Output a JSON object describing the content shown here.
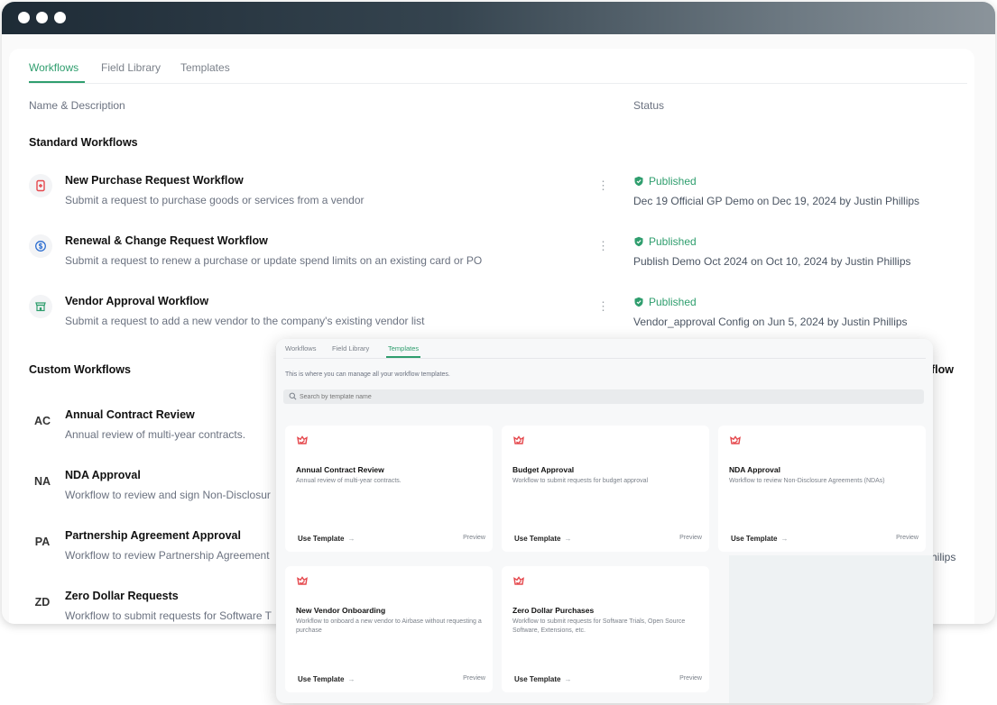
{
  "tabs": [
    "Workflows",
    "Field Library",
    "Templates"
  ],
  "columns": {
    "name": "Name & Description",
    "status": "Status"
  },
  "sections": {
    "standard": "Standard Workflows",
    "custom": "Custom Workflows"
  },
  "standard_workflows": [
    {
      "title": "New Purchase Request Workflow",
      "desc": "Submit a request to purchase goods or services from a vendor",
      "icon": "document-plus-icon",
      "status": "Published",
      "meta": "Dec 19 Official GP Demo on Dec 19, 2024 by Justin Phillips"
    },
    {
      "title": "Renewal & Change Request Workflow",
      "desc": "Submit a request to renew a purchase or update spend limits on an existing card or PO",
      "icon": "dollar-renew-icon",
      "status": "Published",
      "meta": "Publish Demo Oct 2024 on Oct 10, 2024 by Justin Phillips"
    },
    {
      "title": "Vendor Approval Workflow",
      "desc": "Submit a request to add a new vendor to the company's existing vendor list",
      "icon": "store-icon",
      "status": "Published",
      "meta": "Vendor_approval Config on Jun 5, 2024 by Justin Phillips"
    }
  ],
  "custom_workflows": [
    {
      "initials": "AC",
      "title": "Annual Contract Review",
      "desc": "Annual review of multi-year contracts."
    },
    {
      "initials": "NA",
      "title": "NDA Approval",
      "desc": "Workflow to review and sign Non-Disclosur"
    },
    {
      "initials": "PA",
      "title": "Partnership Agreement Approval",
      "desc": "Workflow to review Partnership Agreement"
    },
    {
      "initials": "ZD",
      "title": "Zero Dollar Requests",
      "desc": "Workflow to submit requests for Software T"
    }
  ],
  "partial_right": {
    "custom_header_fragment": "flow",
    "row_fragment": "hilips"
  },
  "overlay": {
    "tabs": [
      "Workflows",
      "Field Library",
      "Templates"
    ],
    "helper": "This is where you can manage all your workflow templates.",
    "search_placeholder": "Search by template name",
    "use_label": "Use Template",
    "preview_label": "Preview",
    "templates": [
      {
        "title": "Annual Contract Review",
        "desc": "Annual review of multi-year contracts."
      },
      {
        "title": "Budget Approval",
        "desc": "Workflow to submit requests for budget approval"
      },
      {
        "title": "NDA Approval",
        "desc": "Workflow to review Non-Disclosure Agreements (NDAs)"
      },
      {
        "title": "New Vendor Onboarding",
        "desc": "Workflow to onboard a new vendor to Airbase without requesting a purchase"
      },
      {
        "title": "Zero Dollar Purchases",
        "desc": "Workflow to submit requests for Software Trials, Open Source Software, Extensions, etc."
      }
    ]
  },
  "colors": {
    "accent": "#2f9e6e",
    "template_icon": "#e5484d"
  }
}
